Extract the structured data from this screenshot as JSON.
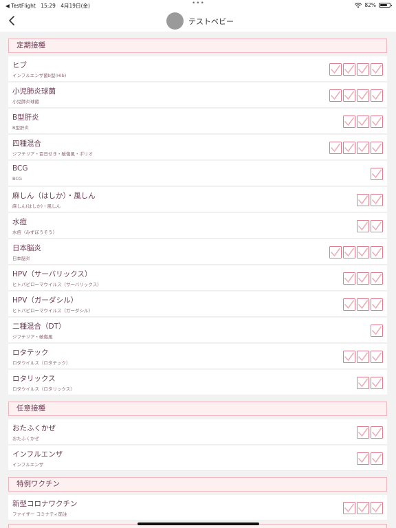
{
  "status_bar": {
    "back_app": "◀ TestFlight",
    "time": "15:29",
    "date": "4月19日(金)",
    "battery": "82%",
    "battery_level": 0.82
  },
  "nav": {
    "title": "テストベビー"
  },
  "sections": [
    {
      "title": "定期接種",
      "rows": [
        {
          "title": "ヒブ",
          "subtitle": "インフルエンザ菌b型(Hib)",
          "checks": 4
        },
        {
          "title": "小児肺炎球菌",
          "subtitle": "小児肺炎球菌",
          "checks": 4
        },
        {
          "title": "B型肝炎",
          "subtitle": "B型肝炎",
          "checks": 3
        },
        {
          "title": "四種混合",
          "subtitle": "ジフテリア・百日せき・破傷風・ポリオ",
          "checks": 4
        },
        {
          "title": "BCG",
          "subtitle": "BCG",
          "checks": 1
        },
        {
          "title": "麻しん（はしか）・風しん",
          "subtitle": "麻しん(はしか)・風しん",
          "checks": 2
        },
        {
          "title": "水痘",
          "subtitle": "水痘（みずぼうそう）",
          "checks": 2
        },
        {
          "title": "日本脳炎",
          "subtitle": "日本脳炎",
          "checks": 4
        },
        {
          "title": "HPV（サーバリックス）",
          "subtitle": "ヒトパピローマウイルス（サーバリックス）",
          "checks": 3
        },
        {
          "title": "HPV（ガーダシル）",
          "subtitle": "ヒトパピローマウイルス（ガーダシル）",
          "checks": 3
        },
        {
          "title": "二種混合（DT）",
          "subtitle": "ジフテリア・破傷風",
          "checks": 1
        },
        {
          "title": "ロタテック",
          "subtitle": "ロタウイルス（ロタテック）",
          "checks": 3
        },
        {
          "title": "ロタリックス",
          "subtitle": "ロタウイルス（ロタリックス）",
          "checks": 2
        }
      ]
    },
    {
      "title": "任意接種",
      "rows": [
        {
          "title": "おたふくかぜ",
          "subtitle": "おたふくかぜ",
          "checks": 2
        },
        {
          "title": "インフルエンザ",
          "subtitle": "インフルエンザ",
          "checks": 2
        }
      ]
    },
    {
      "title": "特例ワクチン",
      "rows": [
        {
          "title": "新型コロナワクチン",
          "subtitle": "ファイザー コミナティ筋注",
          "checks": 3
        }
      ]
    }
  ],
  "icons": {
    "back": "chevron-left-icon",
    "check": "checkmark-icon",
    "wifi": "wifi-icon",
    "battery": "battery-icon",
    "avatar": "avatar"
  },
  "colors": {
    "accent": "#e07c8d",
    "text": "#6b3b52",
    "section_bg": "#fdf0f1",
    "avatar": "#9a9a9a"
  }
}
